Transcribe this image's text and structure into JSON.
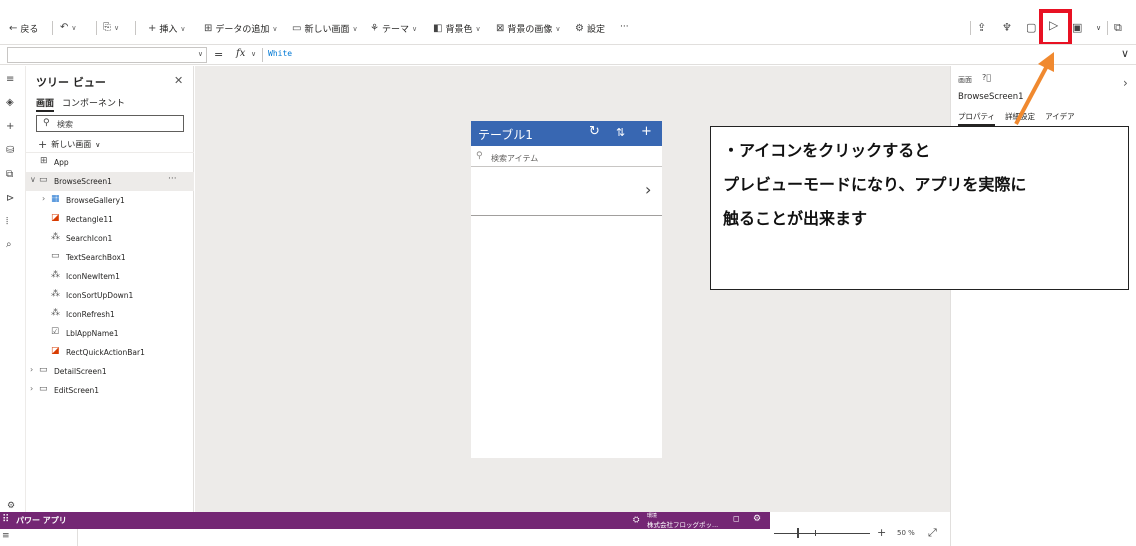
{
  "toolbar": {
    "back": "戻る",
    "insert": "挿入",
    "add_data": "データの追加",
    "new_screen": "新しい画面",
    "theme": "テーマ",
    "background_color": "背景色",
    "background_image": "背景の画像",
    "settings": "設定",
    "more": "···"
  },
  "formula": {
    "eq": "=",
    "fx": "fx",
    "value": "White"
  },
  "tree": {
    "title": "ツリー ビュー",
    "tab_screens": "画面",
    "tab_components": "コンポーネント",
    "search_placeholder": "検索",
    "new_screen": "新しい画面",
    "nodes": [
      {
        "label": "App"
      },
      {
        "label": "BrowseScreen1"
      },
      {
        "label": "BrowseGallery1"
      },
      {
        "label": "Rectangle11"
      },
      {
        "label": "SearchIcon1"
      },
      {
        "label": "TextSearchBox1"
      },
      {
        "label": "IconNewItem1"
      },
      {
        "label": "IconSortUpDown1"
      },
      {
        "label": "IconRefresh1"
      },
      {
        "label": "LblAppName1"
      },
      {
        "label": "RectQuickActionBar1"
      },
      {
        "label": "DetailScreen1"
      },
      {
        "label": "EditScreen1"
      }
    ]
  },
  "app_preview": {
    "title": "テーブル1",
    "search_placeholder": "検索アイテム"
  },
  "properties": {
    "kind": "画面",
    "name": "BrowseScreen1",
    "tabs": [
      "プロパティ",
      "詳細設定",
      "アイデア"
    ]
  },
  "callout": {
    "line1": "・アイコンをクリックすると",
    "line2": "プレビューモードになり、アプリを実際に",
    "line3": "触ることが出来ます"
  },
  "appbar": {
    "name": "パワー アプリ",
    "env_label": "環境",
    "env_value": "株式会社フロッグポッ..."
  },
  "zoom": {
    "percent": "50 %",
    "level": 0.5
  },
  "colors": {
    "app_header": "#3867b2",
    "appbar": "#742774",
    "highlight": "#e81123",
    "arrow": "#f0892f"
  },
  "icons": {
    "play": "play-icon",
    "undo": "undo-icon",
    "paste": "paste-icon"
  }
}
